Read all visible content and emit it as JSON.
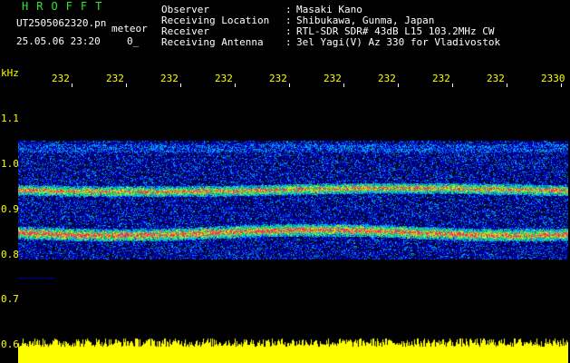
{
  "header": {
    "logo": "HROFFT",
    "filename": "UT2505062320.pn",
    "meteor_label": "meteor",
    "datetime": "25.05.06 23:20",
    "count": "0_",
    "info": [
      {
        "label": "Observer",
        "sep": ":",
        "value": "Masaki Kano"
      },
      {
        "label": "Receiving Location",
        "sep": ":",
        "value": "Shibukawa, Gunma, Japan"
      },
      {
        "label": "Receiver",
        "sep": ":",
        "value": "RTL-SDR SDR# 43dB L15 103.2MHz CW"
      },
      {
        "label": "Receiving Antenna",
        "sep": ":",
        "value": "3el Yagi(V) Az 330 for Vladivostok"
      }
    ]
  },
  "axis": {
    "unit": "kHz",
    "y_labels": [
      "1.1",
      "1.0",
      "0.9",
      "0.8",
      "0.7",
      "0.6"
    ],
    "time_labels": [
      "232",
      "232",
      "232",
      "232",
      "232",
      "232",
      "232",
      "232",
      "232",
      "2330"
    ]
  },
  "colors": {
    "text": "#ffffff",
    "accent": "#ffff00",
    "logo": "#2ee62e",
    "background": "#000000"
  }
}
